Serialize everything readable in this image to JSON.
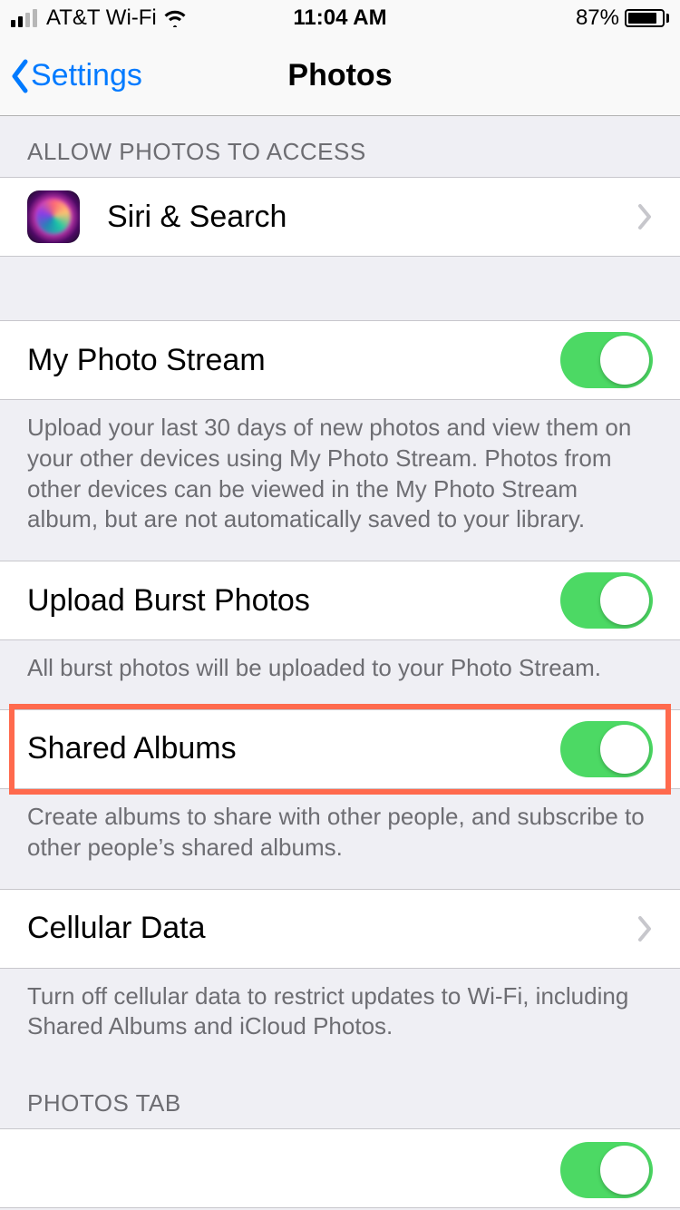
{
  "status": {
    "carrier": "AT&T Wi-Fi",
    "time": "11:04 AM",
    "battery_pct": "87%"
  },
  "nav": {
    "back_label": "Settings",
    "title": "Photos"
  },
  "sections": {
    "access_header": "ALLOW PHOTOS TO ACCESS",
    "siri_search": "Siri & Search",
    "my_photo_stream": "My Photo Stream",
    "my_photo_stream_footer": "Upload your last 30 days of new photos and view them on your other devices using My Photo Stream. Photos from other devices can be viewed in the My Photo Stream album, but are not automatically saved to your library.",
    "upload_burst": "Upload Burst Photos",
    "upload_burst_footer": "All burst photos will be uploaded to your Photo Stream.",
    "shared_albums": "Shared Albums",
    "shared_albums_footer": "Create albums to share with other people, and subscribe to other people’s shared albums.",
    "cellular_data": "Cellular Data",
    "cellular_data_footer": "Turn off cellular data to restrict updates to Wi-Fi, including Shared Albums and iCloud Photos.",
    "photos_tab_header": "PHOTOS TAB"
  }
}
